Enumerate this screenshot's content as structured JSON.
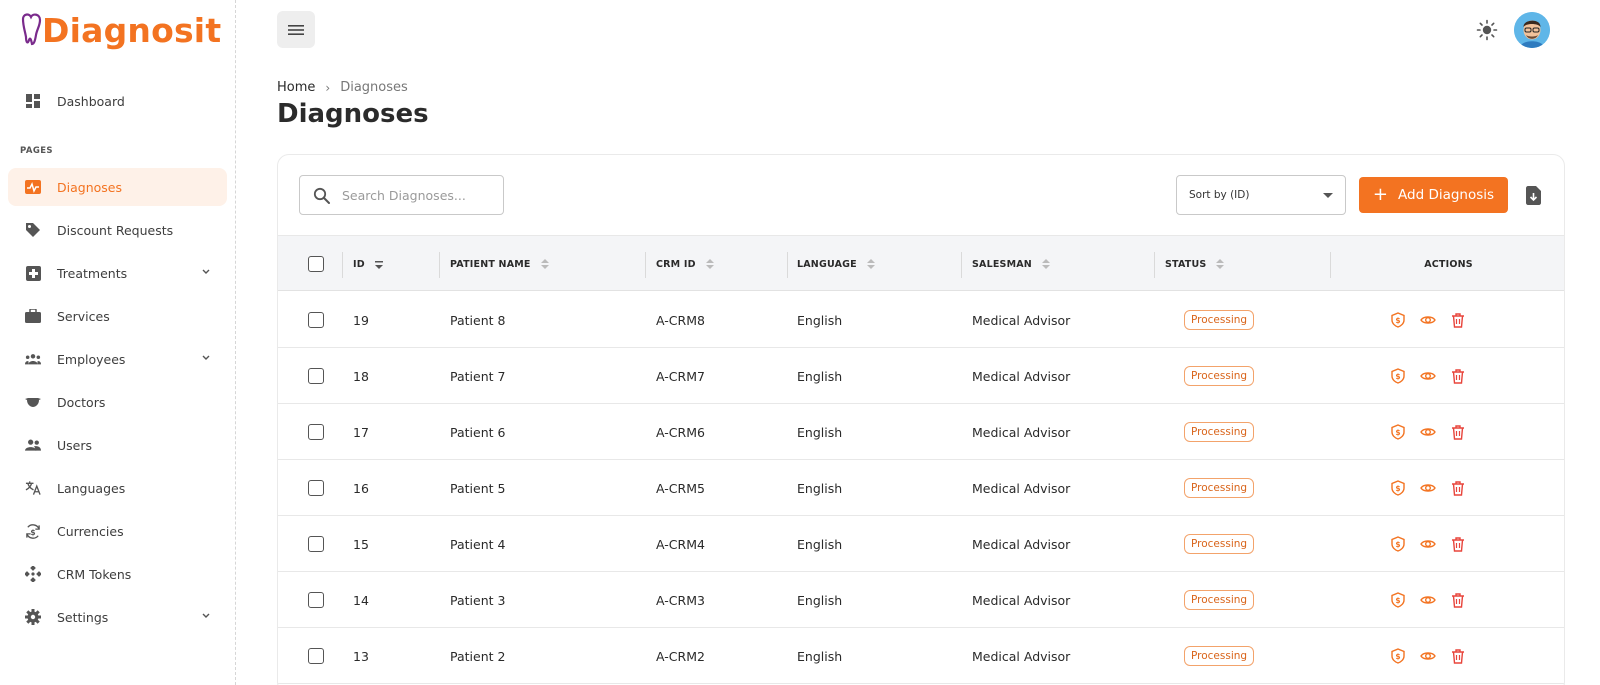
{
  "brand": {
    "name": "Diagnosit",
    "color": "#f37321"
  },
  "sidebar": {
    "section_label": "PAGES",
    "items": [
      {
        "label": "Dashboard",
        "icon": "dashboard-icon"
      },
      {
        "label": "Diagnoses",
        "icon": "pulse-icon",
        "active": true
      },
      {
        "label": "Discount Requests",
        "icon": "tag-icon"
      },
      {
        "label": "Treatments",
        "icon": "medical-plus-icon",
        "expandable": true
      },
      {
        "label": "Services",
        "icon": "briefcase-icon"
      },
      {
        "label": "Employees",
        "icon": "group-icon",
        "expandable": true
      },
      {
        "label": "Doctors",
        "icon": "mask-icon"
      },
      {
        "label": "Users",
        "icon": "users-icon"
      },
      {
        "label": "Languages",
        "icon": "translate-icon"
      },
      {
        "label": "Currencies",
        "icon": "currency-icon"
      },
      {
        "label": "CRM Tokens",
        "icon": "token-icon"
      },
      {
        "label": "Settings",
        "icon": "gear-icon",
        "expandable": true
      }
    ]
  },
  "breadcrumb": {
    "home": "Home",
    "separator": "›",
    "current": "Diagnoses"
  },
  "page_title": "Diagnoses",
  "toolbar": {
    "search_placeholder": "Search Diagnoses...",
    "sort_value": "Sort by (ID)",
    "add_label": "Add Diagnosis"
  },
  "table": {
    "columns": [
      "ID",
      "PATIENT NAME",
      "CRM ID",
      "LANGUAGE",
      "SALESMAN",
      "STATUS",
      "ACTIONS"
    ],
    "rows": [
      {
        "id": "19",
        "patient": "Patient 8",
        "crm": "A-CRM8",
        "language": "English",
        "salesman": "Medical Advisor",
        "status": "Processing"
      },
      {
        "id": "18",
        "patient": "Patient 7",
        "crm": "A-CRM7",
        "language": "English",
        "salesman": "Medical Advisor",
        "status": "Processing"
      },
      {
        "id": "17",
        "patient": "Patient 6",
        "crm": "A-CRM6",
        "language": "English",
        "salesman": "Medical Advisor",
        "status": "Processing"
      },
      {
        "id": "16",
        "patient": "Patient 5",
        "crm": "A-CRM5",
        "language": "English",
        "salesman": "Medical Advisor",
        "status": "Processing"
      },
      {
        "id": "15",
        "patient": "Patient 4",
        "crm": "A-CRM4",
        "language": "English",
        "salesman": "Medical Advisor",
        "status": "Processing"
      },
      {
        "id": "14",
        "patient": "Patient 3",
        "crm": "A-CRM3",
        "language": "English",
        "salesman": "Medical Advisor",
        "status": "Processing"
      },
      {
        "id": "13",
        "patient": "Patient 2",
        "crm": "A-CRM2",
        "language": "English",
        "salesman": "Medical Advisor",
        "status": "Processing"
      }
    ],
    "row_actions": [
      "discount-icon",
      "view-icon",
      "delete-icon"
    ]
  }
}
